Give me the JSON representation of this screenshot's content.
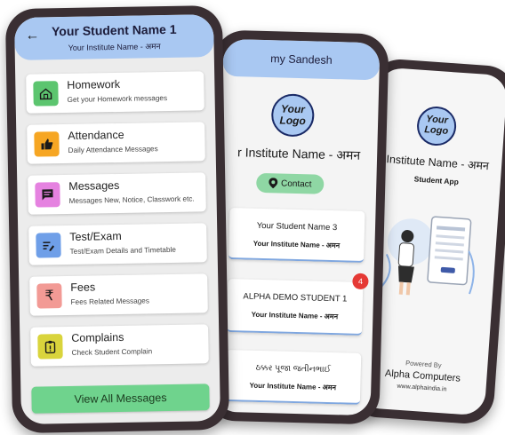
{
  "phone1": {
    "header": {
      "back_icon": "back-arrow-icon",
      "title": "Your Student Name 1",
      "subtitle": "Your Institute Name - अमन"
    },
    "menu": [
      {
        "title": "Homework",
        "desc": "Get your Homework messages",
        "icon": "homework-icon",
        "color": "#5cc56f"
      },
      {
        "title": "Attendance",
        "desc": "Daily Attendance Messages",
        "icon": "thumbs-up-icon",
        "color": "#f6a623"
      },
      {
        "title": "Messages",
        "desc": "Messages New, Notice, Classwork etc.",
        "icon": "message-icon",
        "color": "#e582e0"
      },
      {
        "title": "Test/Exam",
        "desc": "Test/Exam Details and Timetable",
        "icon": "exam-icon",
        "color": "#6f9fe8"
      },
      {
        "title": "Fees",
        "desc": "Fees Related Messages",
        "icon": "rupee-icon",
        "color": "#f29a95"
      },
      {
        "title": "Complains",
        "desc": "Check Student Complain",
        "icon": "complain-icon",
        "color": "#d9d43c"
      }
    ],
    "view_all_label": "View All Messages"
  },
  "phone2": {
    "header_title": "my Sandesh",
    "logo": {
      "line1": "Your",
      "line2": "Logo"
    },
    "institute_name": "r Institute Name - अमन",
    "contact_label": "Contact",
    "students": [
      {
        "name": "Your Student Name 3",
        "institute": "Your Institute Name - अमन",
        "badge": ""
      },
      {
        "name": "ALPHA DEMO STUDENT 1",
        "institute": "Your Institute Name - अमन",
        "badge": "4"
      },
      {
        "name": "ઠક્કર પૂજા જતીનભાઈ",
        "institute": "Your Institute Name - अमन",
        "badge": ""
      }
    ]
  },
  "phone3": {
    "logo": {
      "line1": "Your",
      "line2": "Logo"
    },
    "institute_name": "Institute Name - अमन",
    "app_label": "Student App",
    "powered_by": "Powered By",
    "company": "Alpha Computers",
    "url": "www.alphaindia.in"
  },
  "colors": {
    "header_blue": "#a9c8f2",
    "accent_green": "#6fd38d",
    "badge_red": "#e53935"
  }
}
